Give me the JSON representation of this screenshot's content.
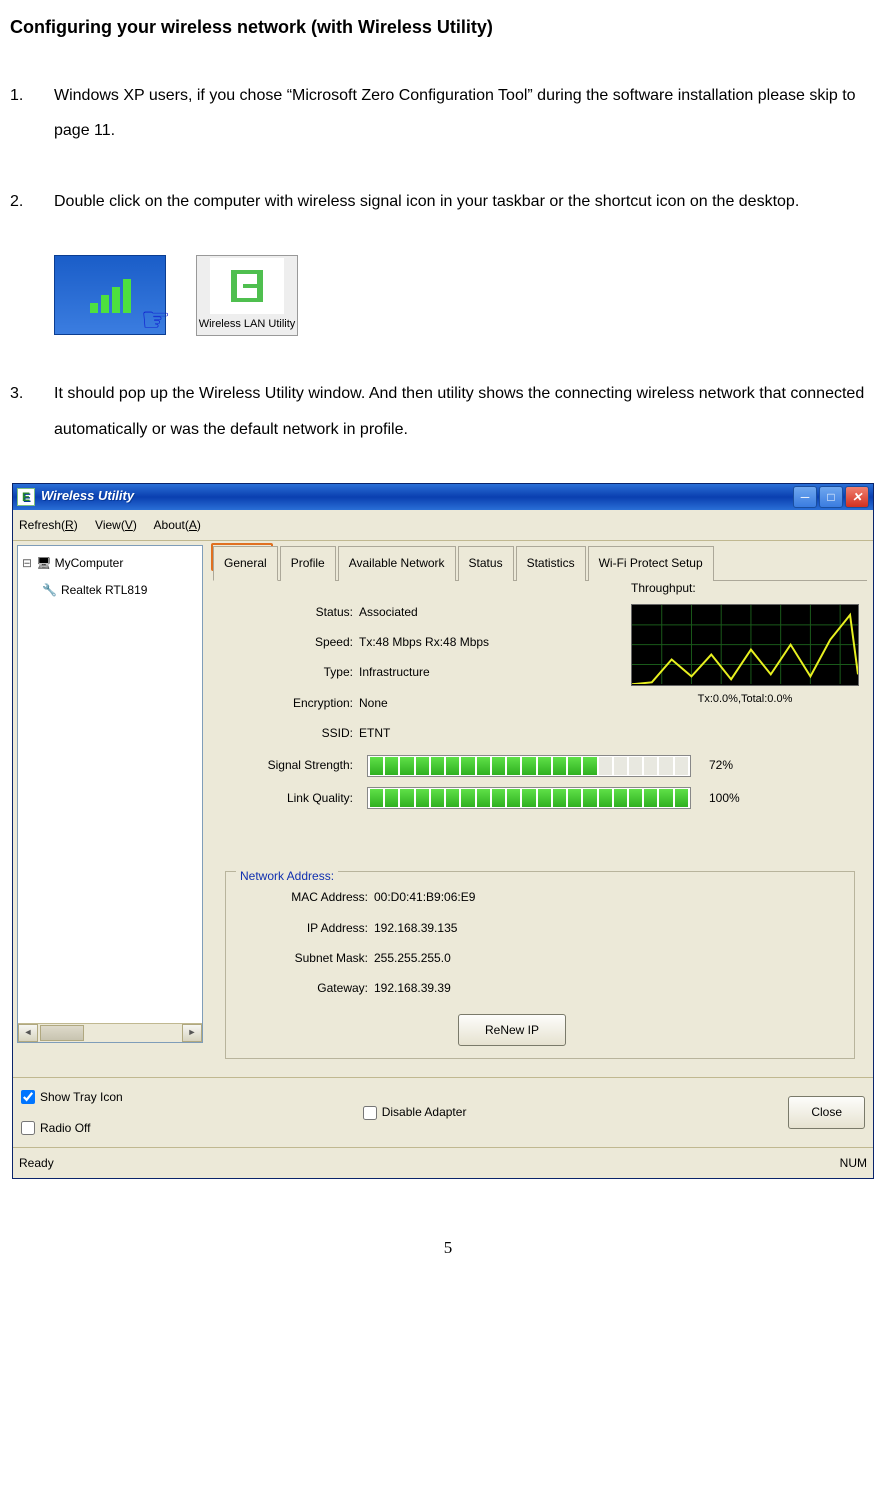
{
  "heading": "Configuring your wireless network (with Wireless Utility)",
  "steps": [
    {
      "num": "1.",
      "text": "Windows XP users, if you chose “Microsoft Zero Configuration Tool” during the software installation please skip to page 11."
    },
    {
      "num": "2.",
      "text": "Double click on the computer with wireless signal icon in your taskbar or the shortcut icon on the desktop."
    },
    {
      "num": "3.",
      "text": "It should pop up the Wireless Utility window. And then utility shows the connecting wireless network that connected automatically or was the default network in profile."
    }
  ],
  "desktopIconLabel": "Wireless LAN Utility",
  "window": {
    "title": "Wireless Utility",
    "menu": {
      "refresh": "Refresh(R)",
      "view": "View(V)",
      "about": "About(A)"
    },
    "tree": {
      "root": "MyComputer",
      "child": "Realtek RTL819"
    },
    "tabs": [
      "General",
      "Profile",
      "Available Network",
      "Status",
      "Statistics",
      "Wi-Fi Protect Setup"
    ],
    "activeTab": "General",
    "general": {
      "status": {
        "label": "Status:",
        "value": "Associated"
      },
      "speed": {
        "label": "Speed:",
        "value": "Tx:48 Mbps Rx:48 Mbps"
      },
      "type": {
        "label": "Type:",
        "value": "Infrastructure"
      },
      "encryption": {
        "label": "Encryption:",
        "value": "None"
      },
      "ssid": {
        "label": "SSID:",
        "value": "ETNT"
      },
      "signal": {
        "label": "Signal Strength:",
        "pct": "72%",
        "fill": 15,
        "total": 21
      },
      "link": {
        "label": "Link Quality:",
        "pct": "100%",
        "fill": 21,
        "total": 21
      }
    },
    "throughput": {
      "label": "Throughput:",
      "footer": "Tx:0.0%,Total:0.0%"
    },
    "network": {
      "legend": "Network Address:",
      "mac": {
        "label": "MAC Address:",
        "value": "00:D0:41:B9:06:E9"
      },
      "ip": {
        "label": "IP Address:",
        "value": "192.168.39.135"
      },
      "mask": {
        "label": "Subnet Mask:",
        "value": "255.255.255.0"
      },
      "gw": {
        "label": "Gateway:",
        "value": "192.168.39.39"
      },
      "renew": "ReNew IP"
    },
    "checks": {
      "tray": "Show Tray Icon",
      "disable": "Disable Adapter",
      "radio": "Radio Off"
    },
    "close": "Close",
    "statusbar": {
      "left": "Ready",
      "right": "NUM"
    }
  },
  "pageNumber": "5"
}
